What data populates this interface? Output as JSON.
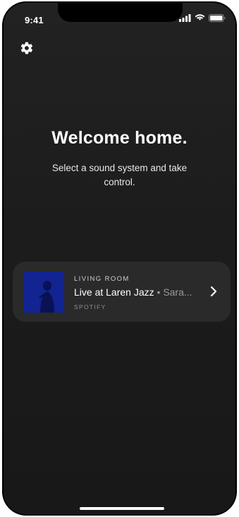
{
  "status_bar": {
    "time": "9:41",
    "icons": [
      "cellular-signal-icon",
      "wifi-icon",
      "battery-icon"
    ]
  },
  "toolbar": {
    "settings_icon": "gear-icon"
  },
  "hero": {
    "title": "Welcome home.",
    "subtitle": "Select a sound system and take control."
  },
  "now_playing_card": {
    "room": "LIVING ROOM",
    "track": "Live at Laren Jazz",
    "separator": "•",
    "artist": "Sara...",
    "source": "Spotify",
    "artwork_icon": "album-artwork",
    "chevron_icon": "chevron-right-icon"
  },
  "colors": {
    "background": "#1c1c1c",
    "card": "#2a2a2a",
    "artwork": "#10208c",
    "text": "#ffffff",
    "muted_text": "#9a9a9a"
  }
}
